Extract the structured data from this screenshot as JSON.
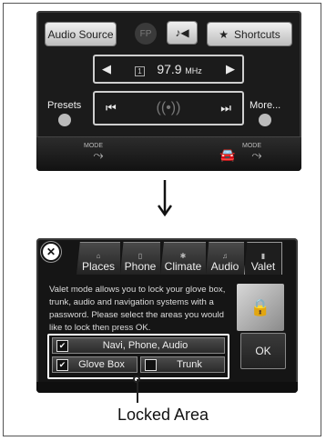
{
  "audio_screen": {
    "audio_source_label": "Audio Source",
    "fp_label": "FP",
    "shortcuts_label": "Shortcuts",
    "preset_number": "1",
    "frequency": "97.9",
    "unit": "MHz",
    "presets_label": "Presets",
    "more_label": "More...",
    "mode_label": "MODE"
  },
  "valet_screen": {
    "tabs": [
      "Places",
      "Phone",
      "Climate",
      "Audio",
      "Valet"
    ],
    "active_tab": "Valet",
    "description": "Valet mode allows you to lock your glove box, trunk, audio and navigation systems with a password. Please select the areas you would like to lock then press OK.",
    "options": [
      {
        "label": "Navi, Phone, Audio",
        "checked": true
      },
      {
        "label": "Glove Box",
        "checked": true
      },
      {
        "label": "Trunk",
        "checked": false
      }
    ],
    "ok_label": "OK"
  },
  "caption": "Locked Area"
}
